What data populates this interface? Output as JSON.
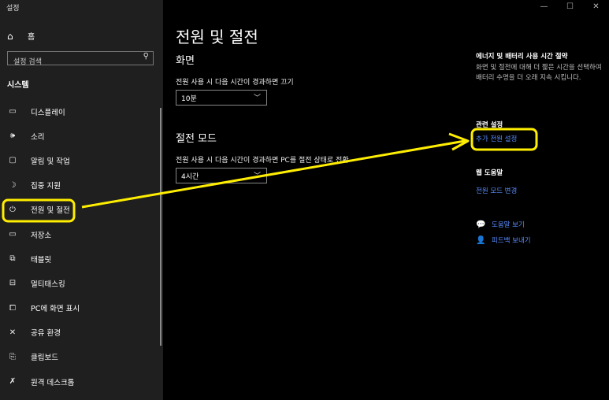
{
  "window": {
    "title": "설정",
    "minimize": "—",
    "maximize": "☐",
    "close": "✕"
  },
  "sidebar": {
    "home_label": "홈",
    "search_placeholder": "설정 검색",
    "section_title": "시스템",
    "items": [
      {
        "label": "디스플레이",
        "icon": "display-icon"
      },
      {
        "label": "소리",
        "icon": "speaker-icon"
      },
      {
        "label": "알림 및 작업",
        "icon": "notification-icon"
      },
      {
        "label": "집중 지원",
        "icon": "moon-icon"
      },
      {
        "label": "전원 및 절전",
        "icon": "power-icon"
      },
      {
        "label": "저장소",
        "icon": "storage-icon"
      },
      {
        "label": "태블릿",
        "icon": "tablet-icon"
      },
      {
        "label": "멀티태스킹",
        "icon": "multitasking-icon"
      },
      {
        "label": "PC에 화면 표시",
        "icon": "project-icon"
      },
      {
        "label": "공유 환경",
        "icon": "share-icon"
      },
      {
        "label": "클립보드",
        "icon": "clipboard-icon"
      },
      {
        "label": "원격 데스크톱",
        "icon": "remote-icon"
      }
    ]
  },
  "main": {
    "title": "전원 및 절전",
    "screen": {
      "heading": "화면",
      "label": "전원 사용 시 다음 시간이 경과하면 끄기",
      "value": "10분"
    },
    "sleep": {
      "heading": "절전 모드",
      "label": "전원 사용 시 다음 시간이 경과하면 PC를 절전 상태로 전환",
      "value": "4시간"
    }
  },
  "right_panel": {
    "tip_heading": "에너지 및 배터리 사용 시간 절약",
    "tip_text": "화면 및 절전에 대해 더 짧은 시간을 선택하여 배터리 수명을 더 오래 지속 시킵니다.",
    "related_heading": "관련 설정",
    "related_link": "추가 전원 설정",
    "web_help_heading": "웹 도움말",
    "web_help_link": "전원 모드 변경",
    "get_help": "도움말 보기",
    "feedback": "피드백 보내기"
  },
  "annotation": {
    "color": "#ffee00"
  }
}
